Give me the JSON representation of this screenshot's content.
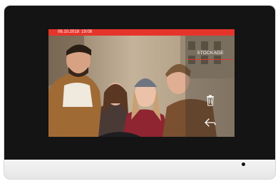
{
  "status_bar": {
    "date": "06.10.2018",
    "time": "19:08"
  },
  "menu": {
    "storage_label": "STOCKAGE"
  },
  "icons": {
    "delete": "trash-icon",
    "back": "back-arrow-icon"
  },
  "colors": {
    "accent": "#e5352b",
    "bezel": "#141414",
    "base": "#e9e9ea"
  }
}
